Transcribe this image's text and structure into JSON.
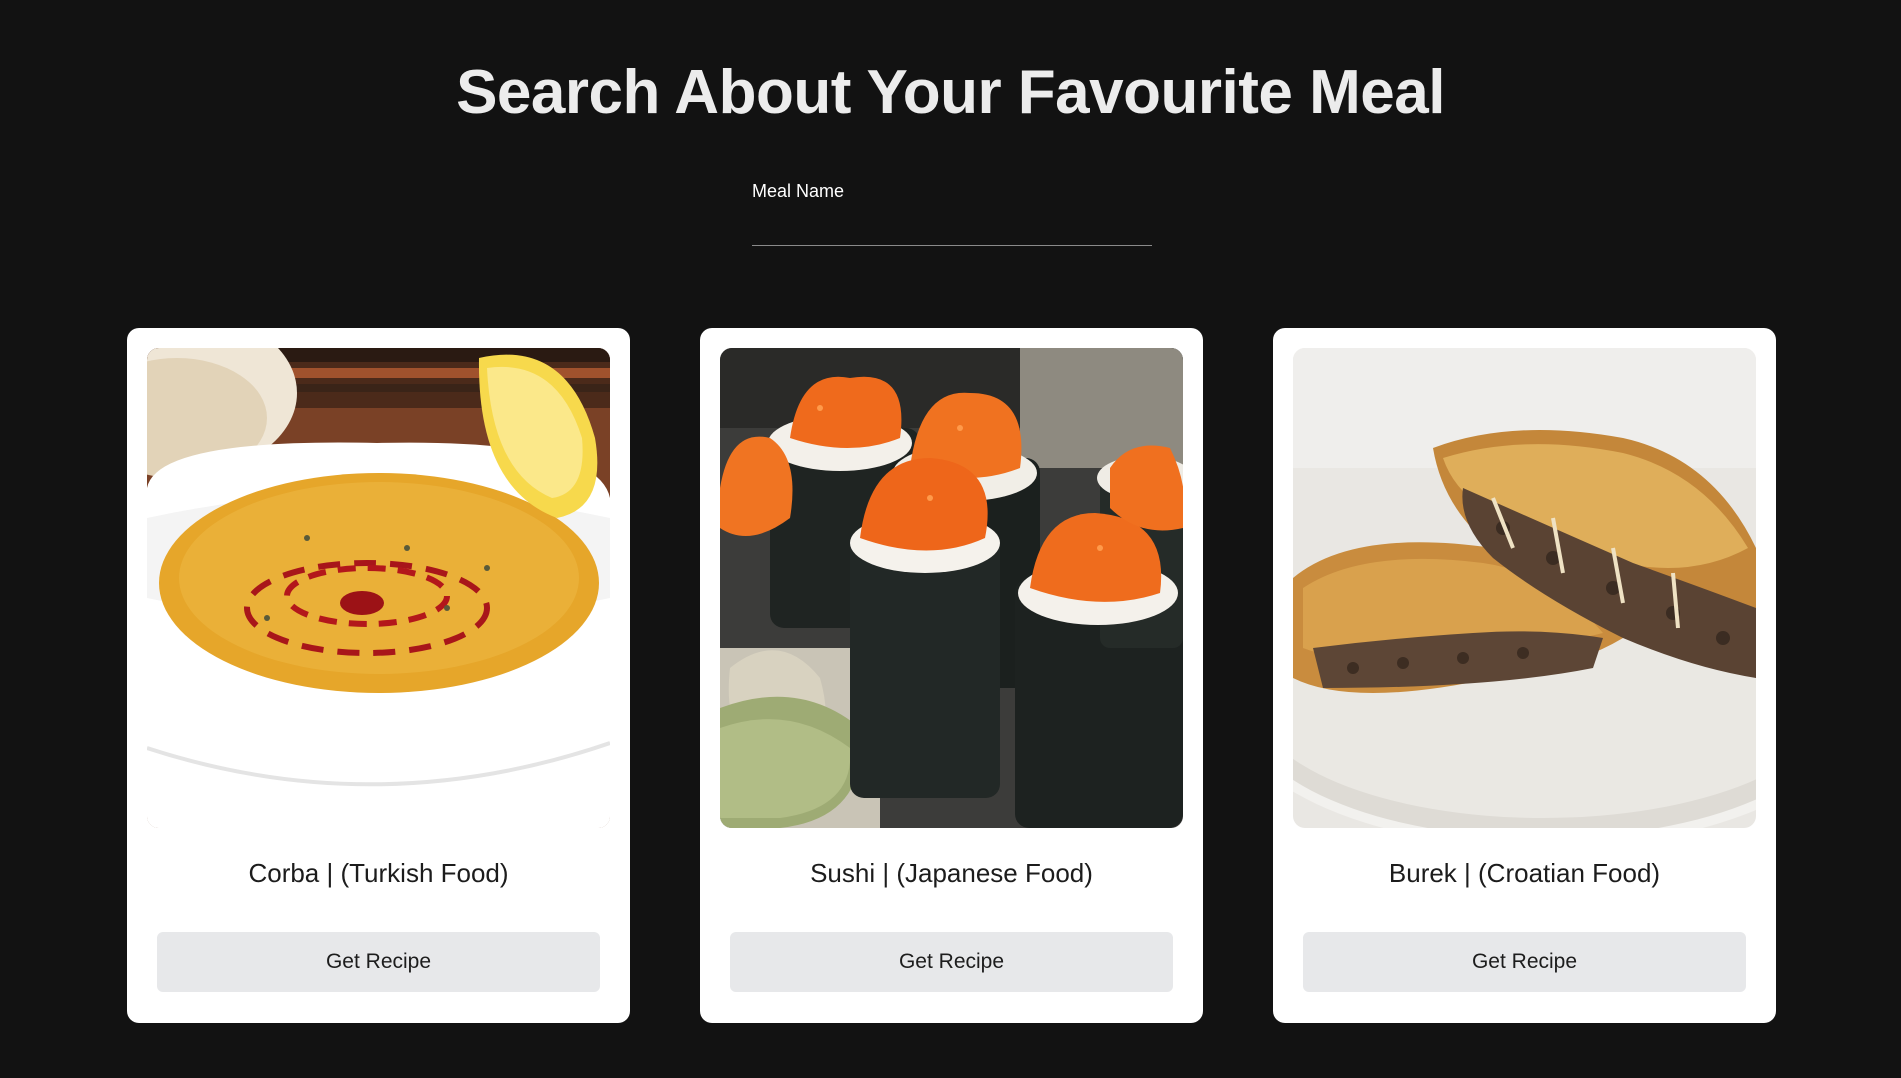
{
  "header": {
    "title": "Search About Your Favourite Meal"
  },
  "search": {
    "label": "Meal Name",
    "value": "",
    "placeholder": ""
  },
  "meals": [
    {
      "name": "Corba | (Turkish Food)",
      "button_label": "Get Recipe",
      "image": "lentil-soup-photo"
    },
    {
      "name": "Sushi | (Japanese Food)",
      "button_label": "Get Recipe",
      "image": "sushi-photo"
    },
    {
      "name": "Burek | (Croatian Food)",
      "button_label": "Get Recipe",
      "image": "burek-photo"
    }
  ],
  "colors": {
    "background": "#121212",
    "title": "#ececec",
    "card": "#ffffff",
    "button": "#e7e8ea"
  }
}
